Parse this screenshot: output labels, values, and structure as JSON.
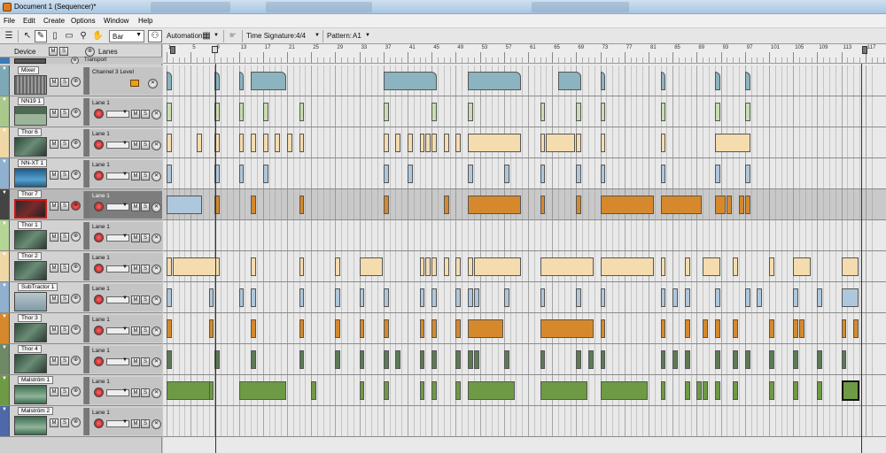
{
  "window": {
    "title": "Document 1 (Sequencer)*"
  },
  "menu": [
    "File",
    "Edit",
    "Create",
    "Options",
    "Window",
    "Help"
  ],
  "toolbar": {
    "snap_value": "Bar",
    "automation_label": "Automation:",
    "time_signature_label": "Time Signature:",
    "time_signature_value": "4/4",
    "pattern_label": "Pattern:",
    "pattern_value": "A1"
  },
  "header": {
    "device_label": "Device",
    "m_label": "M",
    "s_label": "S",
    "lanes_label": "Lanes",
    "transport_label": "Transport"
  },
  "ruler": {
    "bars": [
      "1",
      "5",
      "9",
      "13",
      "17",
      "21",
      "25",
      "29",
      "33",
      "37",
      "41",
      "45",
      "49",
      "53",
      "57",
      "61",
      "65",
      "69",
      "73",
      "77",
      "81",
      "85",
      "89",
      "93",
      "97",
      "101",
      "105",
      "109",
      "113",
      "117"
    ]
  },
  "colors": {
    "mixer": "#8bb3c0",
    "green_light": "#c9ddb0",
    "peach": "#f5dcae",
    "blue_light": "#aec7dc",
    "orange": "#d6892c",
    "dark_green": "#5d7a55",
    "green": "#6e9a45"
  },
  "tracks": [
    {
      "name": "Mixer",
      "lane": "Channel 3 Level",
      "strip": "#7fa8b6",
      "clip_color": "#8bb3c0",
      "thumb": "mixer",
      "clips": [
        [
          1,
          1
        ],
        [
          9,
          1
        ],
        [
          13,
          1
        ],
        [
          15,
          6
        ],
        [
          37,
          9
        ],
        [
          51,
          9
        ],
        [
          66,
          4
        ],
        [
          73,
          1
        ],
        [
          83,
          1
        ],
        [
          92,
          1
        ],
        [
          97,
          1
        ]
      ]
    },
    {
      "name": "NN19 1",
      "lane": "Lane 1",
      "strip": "#a9c98c",
      "clip_color": "#c9ddb0",
      "thumb": "nn19",
      "clips": [
        [
          1,
          1
        ],
        [
          9,
          1
        ],
        [
          13,
          1
        ],
        [
          17,
          1
        ],
        [
          23,
          1
        ],
        [
          37,
          1
        ],
        [
          45,
          1
        ],
        [
          51,
          1
        ],
        [
          63,
          1
        ],
        [
          69,
          1
        ],
        [
          73,
          1
        ],
        [
          83,
          1
        ],
        [
          92,
          1
        ],
        [
          97,
          1
        ]
      ]
    },
    {
      "name": "Thor 6",
      "lane": "Lane 1",
      "strip": "#f0d8a6",
      "clip_color": "#f5dcae",
      "thumb": "thor",
      "clips": [
        [
          1,
          1
        ],
        [
          6,
          1
        ],
        [
          9,
          1
        ],
        [
          13,
          1
        ],
        [
          15,
          1
        ],
        [
          17,
          1
        ],
        [
          19,
          1
        ],
        [
          21,
          1
        ],
        [
          23,
          1
        ],
        [
          37,
          1
        ],
        [
          39,
          1
        ],
        [
          41,
          1
        ],
        [
          43,
          1
        ],
        [
          44,
          1
        ],
        [
          45,
          1
        ],
        [
          47,
          1
        ],
        [
          49,
          1
        ],
        [
          51,
          9
        ],
        [
          63,
          1
        ],
        [
          64,
          5
        ],
        [
          69,
          1
        ],
        [
          73,
          1
        ],
        [
          83,
          1
        ],
        [
          92,
          6
        ]
      ]
    },
    {
      "name": "NN-XT 1",
      "lane": "Lane 1",
      "strip": "#8fb0cf",
      "clip_color": "#aec7dc",
      "thumb": "nnxt",
      "clips": [
        [
          1,
          1
        ],
        [
          9,
          1
        ],
        [
          13,
          1
        ],
        [
          17,
          1
        ],
        [
          37,
          1
        ],
        [
          41,
          1
        ],
        [
          51,
          1
        ],
        [
          57,
          1
        ],
        [
          63,
          1
        ],
        [
          69,
          1
        ],
        [
          73,
          1
        ],
        [
          83,
          1
        ],
        [
          92,
          1
        ],
        [
          97,
          1
        ]
      ]
    },
    {
      "name": "Thor 7",
      "lane": "Lane 1",
      "strip": "#444444",
      "clip_color": "#d6892c",
      "thumb": "thor-sel",
      "selected": true,
      "clips": [
        [
          1,
          6,
          "#aec7dc"
        ],
        [
          9,
          1
        ],
        [
          15,
          1
        ],
        [
          23,
          1
        ],
        [
          37,
          1
        ],
        [
          47,
          1
        ],
        [
          51,
          9
        ],
        [
          63,
          1
        ],
        [
          69,
          1
        ],
        [
          73,
          9
        ],
        [
          83,
          7
        ],
        [
          92,
          2
        ],
        [
          94,
          1
        ],
        [
          96,
          1
        ],
        [
          97,
          1
        ]
      ]
    },
    {
      "name": "Thor 1",
      "lane": "Lane 1",
      "strip": "#b5d596",
      "clip_color": "#c9ddb0",
      "thumb": "thor",
      "clips": []
    },
    {
      "name": "Thor 2",
      "lane": "Lane 1",
      "strip": "#f0d8a6",
      "clip_color": "#f5dcae",
      "thumb": "thor",
      "clips": [
        [
          1,
          1
        ],
        [
          2,
          8
        ],
        [
          15,
          1
        ],
        [
          23,
          1
        ],
        [
          29,
          1
        ],
        [
          33,
          4
        ],
        [
          43,
          1
        ],
        [
          44,
          1
        ],
        [
          45,
          1
        ],
        [
          47,
          1
        ],
        [
          49,
          1
        ],
        [
          51,
          1
        ],
        [
          52,
          8
        ],
        [
          63,
          9
        ],
        [
          73,
          9
        ],
        [
          83,
          1
        ],
        [
          87,
          1
        ],
        [
          90,
          3
        ],
        [
          95,
          1
        ],
        [
          101,
          1
        ],
        [
          105,
          3
        ],
        [
          113,
          3
        ]
      ]
    },
    {
      "name": "SubTractor 1",
      "lane": "Lane 1",
      "strip": "#8fb0cf",
      "clip_color": "#aec7dc",
      "thumb": "subtractor",
      "clips": [
        [
          1,
          1
        ],
        [
          8,
          1
        ],
        [
          13,
          1
        ],
        [
          15,
          1
        ],
        [
          23,
          1
        ],
        [
          29,
          1
        ],
        [
          33,
          1
        ],
        [
          37,
          1
        ],
        [
          43,
          1
        ],
        [
          45,
          1
        ],
        [
          49,
          1
        ],
        [
          51,
          1
        ],
        [
          52,
          1
        ],
        [
          57,
          1
        ],
        [
          63,
          1
        ],
        [
          69,
          1
        ],
        [
          73,
          1
        ],
        [
          83,
          1
        ],
        [
          85,
          1
        ],
        [
          87,
          1
        ],
        [
          92,
          1
        ],
        [
          97,
          1
        ],
        [
          99,
          1
        ],
        [
          105,
          1
        ],
        [
          109,
          1
        ],
        [
          113,
          3
        ]
      ]
    },
    {
      "name": "Thor 3",
      "lane": "Lane 1",
      "strip": "#d6892c",
      "clip_color": "#d6892c",
      "thumb": "thor",
      "clips": [
        [
          1,
          1
        ],
        [
          8,
          1
        ],
        [
          15,
          1
        ],
        [
          23,
          1
        ],
        [
          29,
          1
        ],
        [
          33,
          1
        ],
        [
          37,
          1
        ],
        [
          43,
          1
        ],
        [
          45,
          1
        ],
        [
          49,
          1
        ],
        [
          51,
          6
        ],
        [
          63,
          9
        ],
        [
          73,
          1
        ],
        [
          83,
          1
        ],
        [
          87,
          1
        ],
        [
          90,
          1
        ],
        [
          92,
          1
        ],
        [
          95,
          1
        ],
        [
          101,
          1
        ],
        [
          105,
          1
        ],
        [
          106,
          1
        ],
        [
          113,
          1
        ],
        [
          115,
          1
        ]
      ]
    },
    {
      "name": "Thor 4",
      "lane": "Lane 1",
      "strip": "#6d8966",
      "clip_color": "#5d7a55",
      "thumb": "thor",
      "clips": [
        [
          1,
          1
        ],
        [
          9,
          1
        ],
        [
          15,
          1
        ],
        [
          23,
          1
        ],
        [
          29,
          1
        ],
        [
          33,
          1
        ],
        [
          37,
          1
        ],
        [
          39,
          1
        ],
        [
          43,
          1
        ],
        [
          45,
          1
        ],
        [
          49,
          1
        ],
        [
          51,
          1
        ],
        [
          52,
          1
        ],
        [
          57,
          1
        ],
        [
          63,
          1
        ],
        [
          69,
          1
        ],
        [
          71,
          1
        ],
        [
          73,
          1
        ],
        [
          83,
          1
        ],
        [
          85,
          1
        ],
        [
          87,
          1
        ],
        [
          92,
          1
        ],
        [
          95,
          1
        ],
        [
          97,
          1
        ],
        [
          101,
          1
        ],
        [
          105,
          1
        ],
        [
          109,
          1
        ],
        [
          113,
          1
        ]
      ]
    },
    {
      "name": "Malström 1",
      "lane": "Lane 1",
      "strip": "#6e9a45",
      "clip_color": "#6e9a45",
      "thumb": "malstrom",
      "clips": [
        [
          1,
          8
        ],
        [
          8,
          1
        ],
        [
          13,
          8
        ],
        [
          25,
          1
        ],
        [
          33,
          1
        ],
        [
          37,
          1
        ],
        [
          43,
          1
        ],
        [
          45,
          1
        ],
        [
          49,
          1
        ],
        [
          51,
          8
        ],
        [
          63,
          8
        ],
        [
          73,
          8
        ],
        [
          83,
          1
        ],
        [
          87,
          1
        ],
        [
          89,
          1
        ],
        [
          90,
          1
        ],
        [
          92,
          1
        ],
        [
          95,
          1
        ],
        [
          101,
          1
        ],
        [
          105,
          1
        ],
        [
          109,
          1
        ],
        [
          113,
          3
        ]
      ]
    },
    {
      "name": "Malström 2",
      "lane": "Lane 1",
      "strip": "#4e69a8",
      "clip_color": "#6e9a45",
      "thumb": "malstrom",
      "clips": []
    }
  ]
}
